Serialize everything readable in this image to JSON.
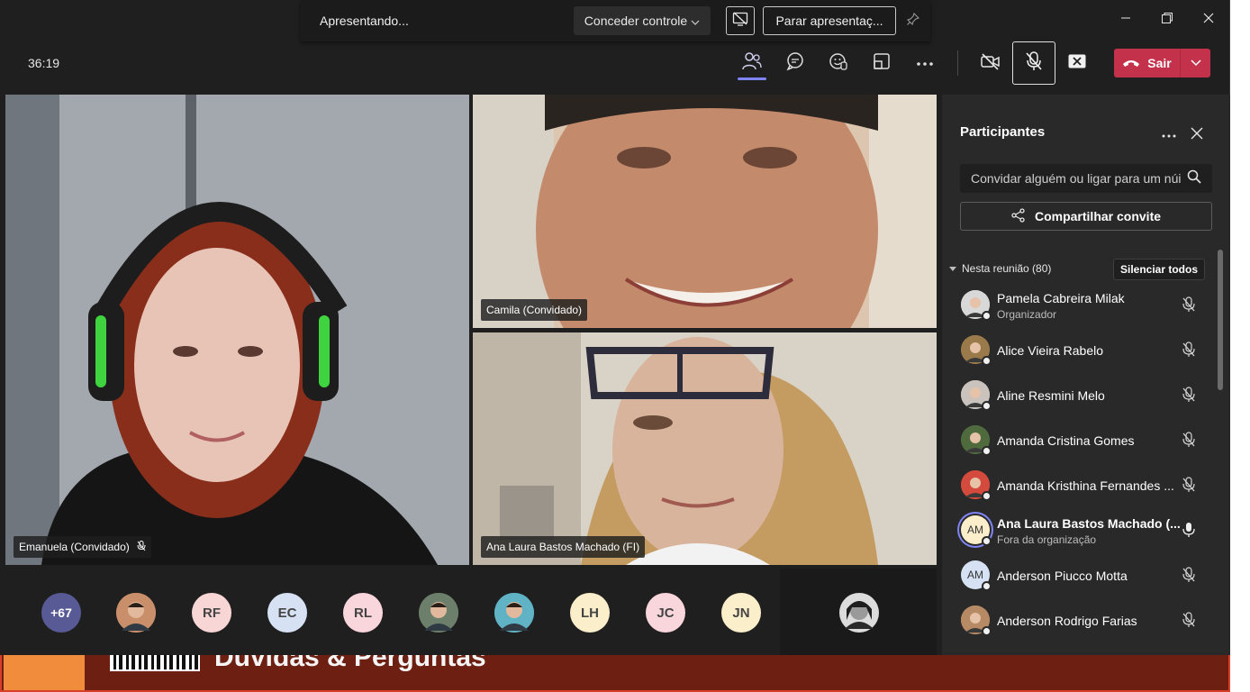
{
  "sharing_bar": {
    "presenting_label": "Apresentando...",
    "give_control_label": "Conceder controle",
    "stop_presenting_label": "Parar apresentaç..."
  },
  "toolbar": {
    "timer": "36:19",
    "leave_label": "Sair"
  },
  "videos": [
    {
      "name": "Emanuela (Convidado)",
      "muted": true
    },
    {
      "name": "Camila (Convidado)",
      "muted": false
    },
    {
      "name": "Ana Laura Bastos Machado (FI)",
      "muted": false
    }
  ],
  "strip": {
    "overflow_count": "+67",
    "avatars": [
      {
        "initials": "",
        "kind": "photo",
        "color": "#c88f6a"
      },
      {
        "initials": "RF",
        "kind": "initials",
        "color": "#f9d6d6"
      },
      {
        "initials": "EC",
        "kind": "initials",
        "color": "#d6e2f4"
      },
      {
        "initials": "RL",
        "kind": "initials",
        "color": "#f9d6dc"
      },
      {
        "initials": "",
        "kind": "photo",
        "color": "#6b7f6a"
      },
      {
        "initials": "",
        "kind": "photo",
        "color": "#5fb3c4"
      },
      {
        "initials": "LH",
        "kind": "initials",
        "color": "#fbeecb"
      },
      {
        "initials": "JC",
        "kind": "initials",
        "color": "#f9d6dc"
      },
      {
        "initials": "JN",
        "kind": "initials",
        "color": "#fbeecb"
      }
    ]
  },
  "panel": {
    "title": "Participantes",
    "invite_placeholder": "Convidar alguém ou ligar para um núi",
    "share_invite_label": "Compartilhar convite",
    "section_label": "Nesta reunião (80)",
    "mute_all_label": "Silenciar todos",
    "participants": [
      {
        "name": "Pamela Cabreira Milak",
        "subtitle": "Organizador",
        "initials": "",
        "avatar_color": "#d8d8d8",
        "mic": "muted"
      },
      {
        "name": "Alice Vieira Rabelo",
        "subtitle": "",
        "initials": "",
        "avatar_color": "#9a7a4a",
        "mic": "muted"
      },
      {
        "name": "Aline Resmini Melo",
        "subtitle": "",
        "initials": "",
        "avatar_color": "#c9c2bd",
        "mic": "muted"
      },
      {
        "name": "Amanda Cristina Gomes",
        "subtitle": "",
        "initials": "",
        "avatar_color": "#4f6b3e",
        "mic": "muted"
      },
      {
        "name": "Amanda Kristhina Fernandes ...",
        "subtitle": "",
        "initials": "",
        "avatar_color": "#d44a3c",
        "mic": "muted"
      },
      {
        "name": "Ana Laura Bastos Machado (...",
        "subtitle": "Fora da organização",
        "initials": "AM",
        "avatar_color": "#fbeecb",
        "mic": "on"
      },
      {
        "name": "Anderson Piucco Motta",
        "subtitle": "",
        "initials": "AM",
        "avatar_color": "#d6e2f4",
        "mic": "muted"
      },
      {
        "name": "Anderson Rodrigo Farias",
        "subtitle": "",
        "initials": "",
        "avatar_color": "#b58a64",
        "mic": "muted"
      }
    ]
  },
  "shared_content": {
    "title_fragment": "Dúvidas & Perguntas"
  },
  "colors": {
    "leave_red": "#c4314b",
    "accent": "#7f85f5",
    "overflow_avatar": "#585a96"
  }
}
